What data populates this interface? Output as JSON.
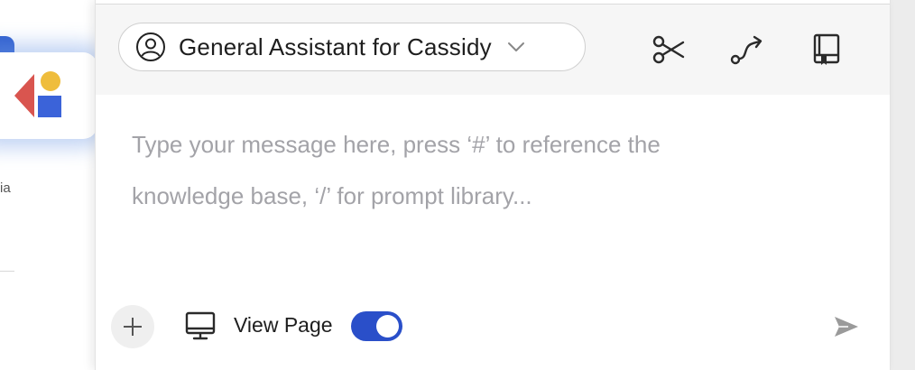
{
  "background": {
    "partial_text": "ia"
  },
  "header": {
    "assistant_selector": {
      "label": "General Assistant for Cassidy"
    },
    "icons": [
      "scissors-icon",
      "route-icon",
      "book-icon"
    ]
  },
  "composer": {
    "placeholder_line1": "Type your message here, press ‘#’ to reference the",
    "placeholder_line2": "knowledge base, ‘/’ for prompt library..."
  },
  "footer": {
    "view_page_label": "View Page",
    "view_page_enabled": true
  },
  "colors": {
    "accent": "#2a4fc9",
    "placeholder": "#a3a3a8",
    "header_bg": "#f6f6f6"
  }
}
